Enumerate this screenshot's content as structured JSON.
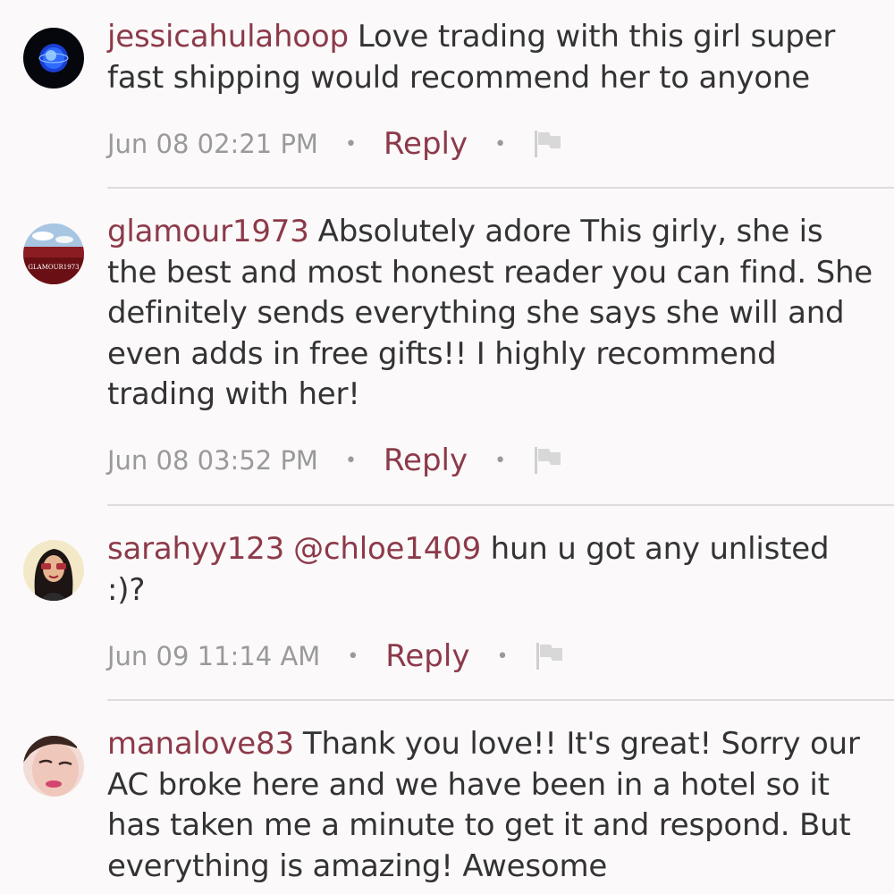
{
  "comments": [
    {
      "username": "jessicahulahoop",
      "mention": "",
      "text": "Love trading with this girl super fast shipping would recommend her to anyone",
      "time": "Jun 08 02:21 PM",
      "reply_label": "Reply",
      "avatar_icon": "blue-orb-avatar"
    },
    {
      "username": "glamour1973",
      "mention": "",
      "text": "Absolutely adore This girly, she is the best and most honest reader you can find. She definitely sends everything she says she will and even adds in free gifts!! I highly recommend trading with her!",
      "time": "Jun 08 03:52 PM",
      "reply_label": "Reply",
      "avatar_icon": "landscape-avatar",
      "avatar_caption": "GLAMOUR1973"
    },
    {
      "username": "sarahyy123",
      "mention": "@chloe1409",
      "text": "hun u got any unlisted :)?",
      "time": "Jun 09 11:14 AM",
      "reply_label": "Reply",
      "avatar_icon": "portrait-avatar"
    },
    {
      "username": "manalove83",
      "mention": "",
      "text": "Thank you love!! It's great! Sorry our AC broke here and we have been in a hotel so it has taken me a minute to get it and respond. But everything is amazing! Awesome",
      "avatar_icon": "face-avatar"
    }
  ],
  "colors": {
    "username": "#8c3a4a",
    "body_text": "#333333",
    "meta_text": "#9a9a9a",
    "divider": "#dedddd",
    "background": "#fbf9f9"
  },
  "icons": {
    "flag": "flag-icon",
    "separator": "dot"
  }
}
